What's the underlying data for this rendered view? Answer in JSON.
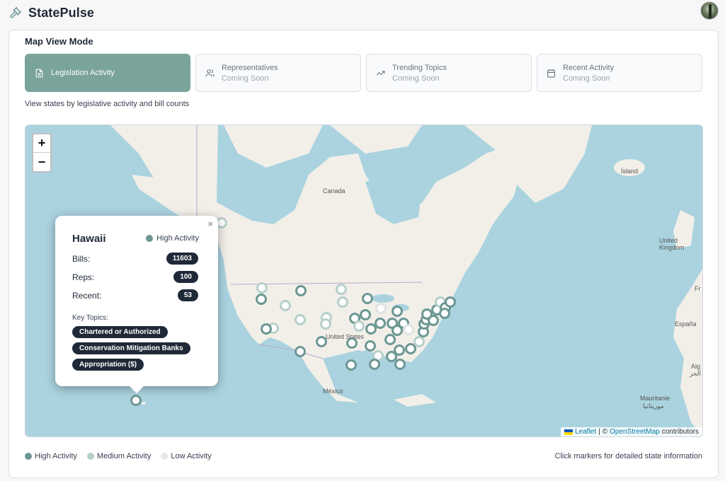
{
  "app": {
    "name": "StatePulse"
  },
  "section_title": "Map View Mode",
  "modes": [
    {
      "label": "Legislation Activity",
      "sub": "",
      "icon": "document-icon",
      "active": true
    },
    {
      "label": "Representatives",
      "sub": "Coming Soon",
      "icon": "users-icon",
      "active": false
    },
    {
      "label": "Trending Topics",
      "sub": "Coming Soon",
      "icon": "trending-up-icon",
      "active": false
    },
    {
      "label": "Recent Activity",
      "sub": "Coming Soon",
      "icon": "calendar-icon",
      "active": false
    }
  ],
  "mode_description": "View states by legislative activity and bill counts",
  "map": {
    "zoom_in": "+",
    "zoom_out": "−",
    "labels": {
      "canada": "Canada",
      "usa": "United States",
      "mexico": "México",
      "iceland": "Ísland",
      "uk": "United Kingdom",
      "spain": "España",
      "fr": "Fr",
      "mauritanie": "Mauritanie",
      "mauritanie_ar": "موريتانيا",
      "alg": "Alg",
      "alg_ar": "الجز"
    },
    "attribution": {
      "leaflet": "Leaflet",
      "separator": "|",
      "copyright": "©",
      "osm": "OpenStreetMap",
      "contributors": "contributors"
    }
  },
  "popup": {
    "state": "Hawaii",
    "activity_level": "High Activity",
    "bills_label": "Bills:",
    "bills": "11603",
    "reps_label": "Reps:",
    "reps": "100",
    "recent_label": "Recent:",
    "recent": "53",
    "close": "×",
    "topics_label": "Key Topics:",
    "topics": [
      "Chartered or Authorized",
      "Conservation Mitigation Banks",
      "Appropriation ($)"
    ]
  },
  "legend": {
    "high": "High Activity",
    "medium": "Medium Activity",
    "low": "Low Activity"
  },
  "hint": "Click markers for detailed state information",
  "colors": {
    "accent": "#7aa39b",
    "high": "#6c9793",
    "medium": "#b7cfcb",
    "low": "#dfe3e3",
    "water": "#aad3df",
    "land": "#f2efe9"
  }
}
